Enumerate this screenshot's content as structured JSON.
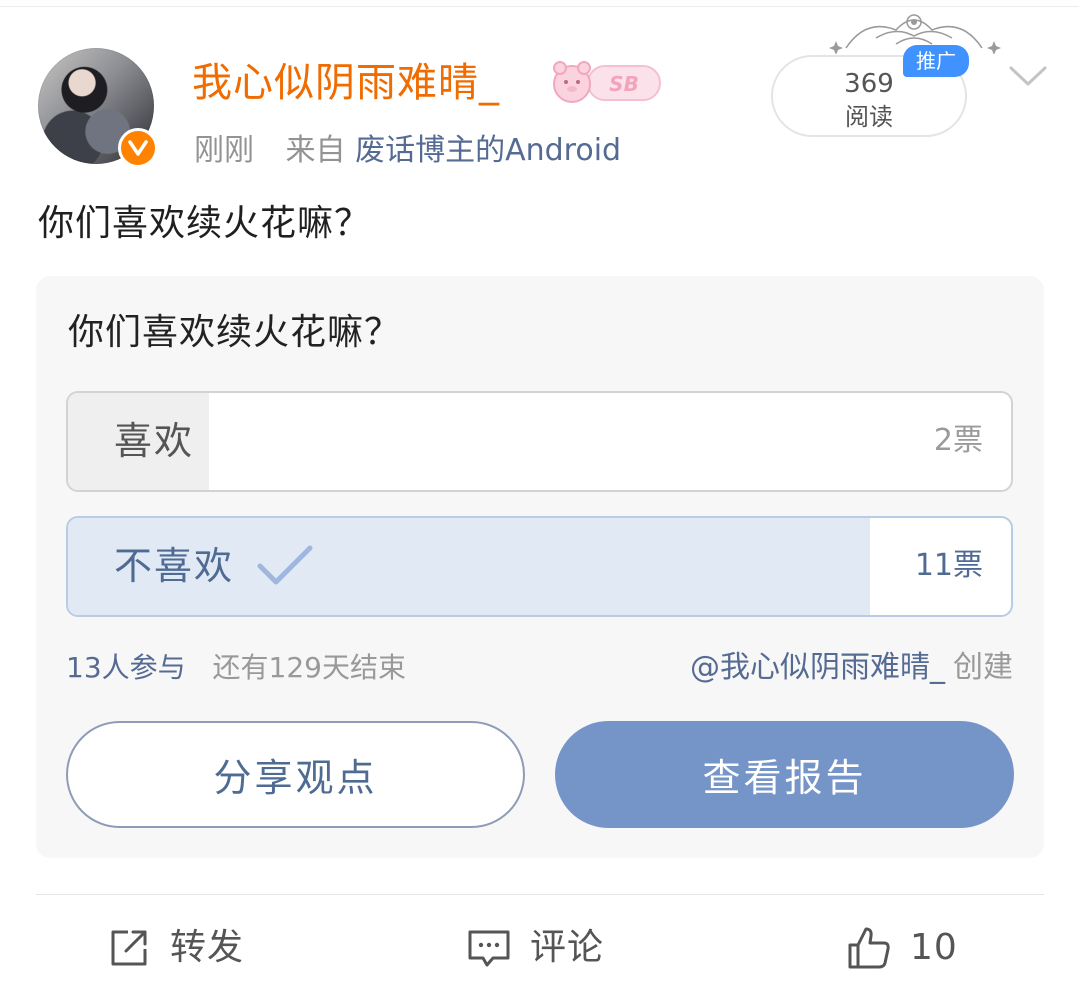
{
  "post": {
    "author": {
      "name": "我心似阴雨难晴_",
      "sticker_text": "SB",
      "verified_badge": "v"
    },
    "time": "刚刚",
    "source_prefix": "来自",
    "source_name": "废话博主的Android",
    "views": {
      "count": "369",
      "label": "阅读",
      "tag": "推广"
    },
    "text": "你们喜欢续火花嘛？"
  },
  "poll": {
    "question": "你们喜欢续火花嘛？",
    "options": [
      {
        "label": "喜欢",
        "votes_text": "2票",
        "votes": 2,
        "selected": false,
        "share": 0.15
      },
      {
        "label": "不喜欢",
        "votes_text": "11票",
        "votes": 11,
        "selected": true,
        "share": 0.85
      }
    ],
    "participants": "13人参与",
    "remaining": "还有129天结束",
    "creator_handle": "@我心似阴雨难晴_",
    "creator_suffix": "创建",
    "share_button": "分享观点",
    "report_button": "查看报告"
  },
  "actions": {
    "repost": "转发",
    "comment": "评论",
    "like_count": "10"
  },
  "colors": {
    "username": "#f06b00",
    "link": "#566b93",
    "accent_button": "#7594c8",
    "selected_fill": "#e1e9f4",
    "verified": "#ff8200",
    "promo": "#3f92ff"
  },
  "icons": [
    "verified-icon",
    "chevron-down-icon",
    "check-icon",
    "repost-icon",
    "comment-icon",
    "like-icon"
  ]
}
